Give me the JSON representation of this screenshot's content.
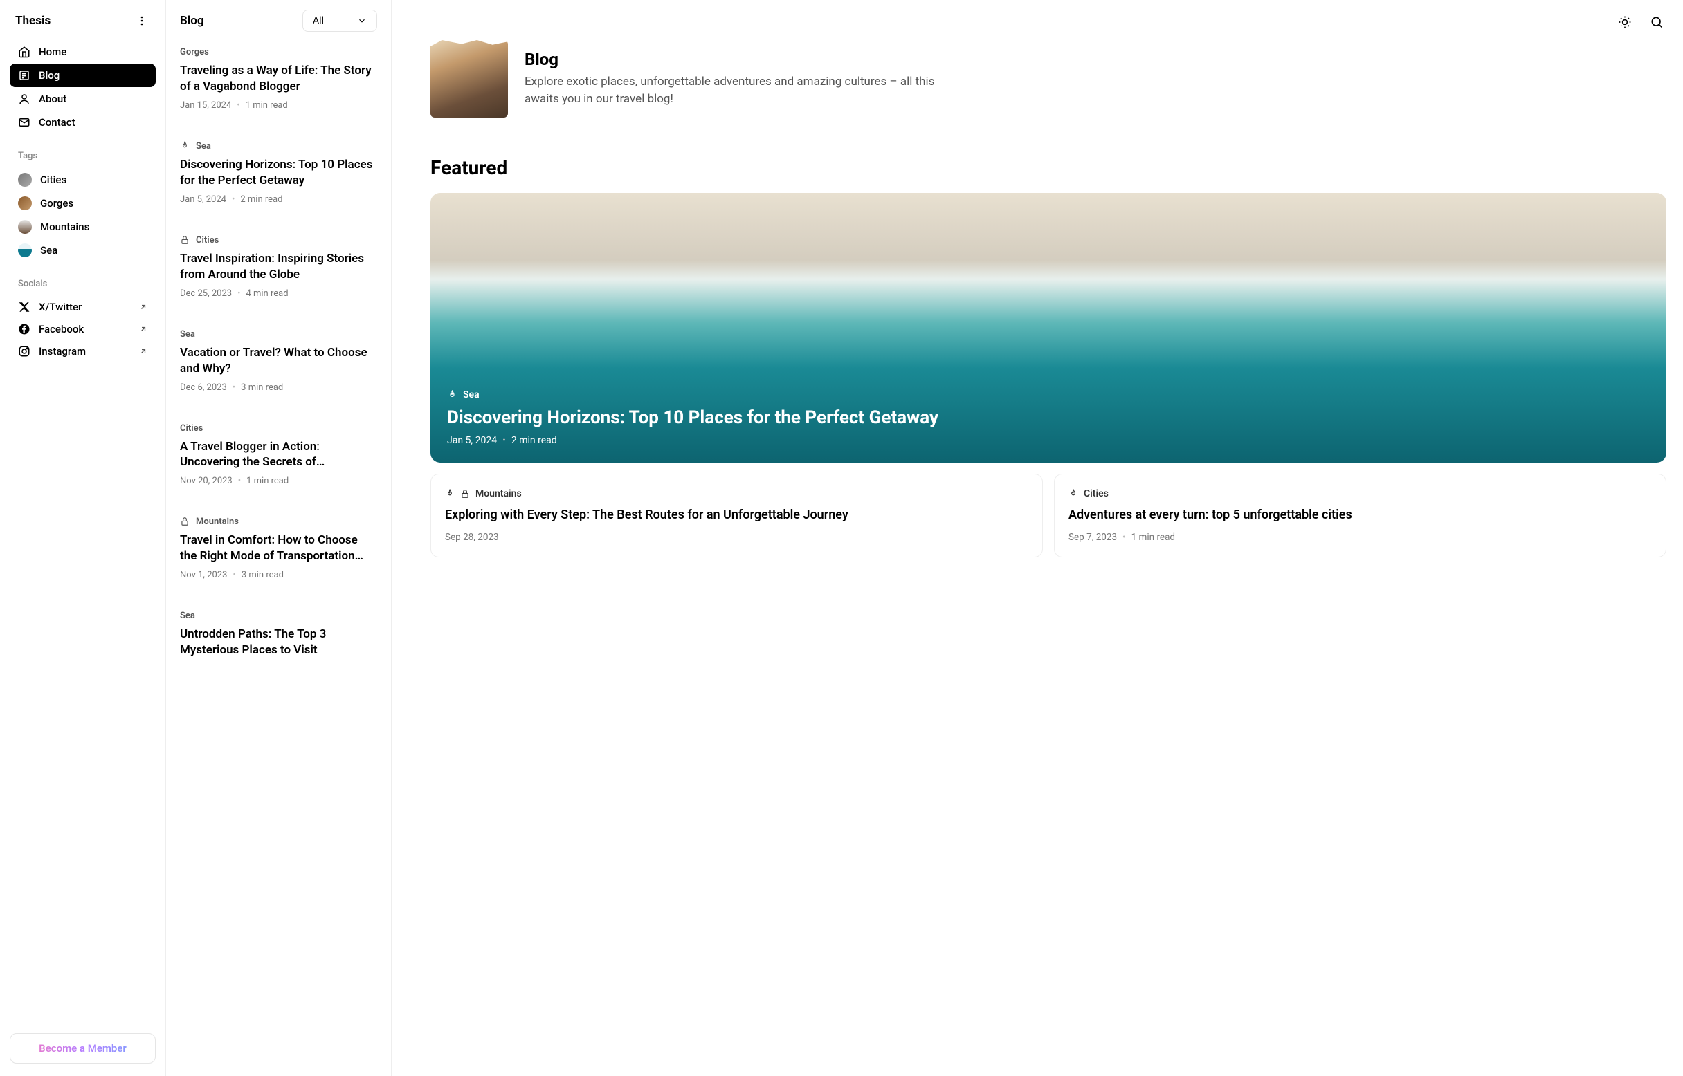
{
  "site": {
    "title": "Thesis",
    "member_cta": "Become a Member"
  },
  "nav": [
    {
      "label": "Home",
      "icon": "home-icon"
    },
    {
      "label": "Blog",
      "icon": "blog-icon",
      "active": true
    },
    {
      "label": "About",
      "icon": "about-icon"
    },
    {
      "label": "Contact",
      "icon": "contact-icon"
    }
  ],
  "tags_label": "Tags",
  "tags": [
    {
      "label": "Cities"
    },
    {
      "label": "Gorges"
    },
    {
      "label": "Mountains"
    },
    {
      "label": "Sea"
    }
  ],
  "socials_label": "Socials",
  "socials": [
    {
      "label": "X/Twitter"
    },
    {
      "label": "Facebook"
    },
    {
      "label": "Instagram"
    }
  ],
  "middle": {
    "title": "Blog",
    "filter": "All",
    "posts": [
      {
        "tag": "Gorges",
        "title": "Traveling as a Way of Life: The Story of a Vagabond Blogger",
        "date": "Jan 15, 2024",
        "read": "1 min read",
        "featured": false,
        "locked": false
      },
      {
        "tag": "Sea",
        "title": "Discovering Horizons: Top 10 Places for the Perfect Getaway",
        "date": "Jan 5, 2024",
        "read": "2 min read",
        "featured": true,
        "locked": false
      },
      {
        "tag": "Cities",
        "title": "Travel Inspiration: Inspiring Stories from Around the Globe",
        "date": "Dec 25, 2023",
        "read": "4 min read",
        "featured": false,
        "locked": true
      },
      {
        "tag": "Sea",
        "title": "Vacation or Travel? What to Choose and Why?",
        "date": "Dec 6, 2023",
        "read": "3 min read",
        "featured": false,
        "locked": false
      },
      {
        "tag": "Cities",
        "title": "A Travel Blogger in Action: Uncovering the Secrets of…",
        "date": "Nov 20, 2023",
        "read": "1 min read",
        "featured": false,
        "locked": false
      },
      {
        "tag": "Mountains",
        "title": "Travel in Comfort: How to Choose the Right Mode of Transportation…",
        "date": "Nov 1, 2023",
        "read": "3 min read",
        "featured": false,
        "locked": true
      },
      {
        "tag": "Sea",
        "title": "Untrodden Paths: The Top 3 Mysterious Places to Visit",
        "date": "",
        "read": "",
        "featured": false,
        "locked": false
      }
    ]
  },
  "main": {
    "blog_title": "Blog",
    "blog_desc": "Explore exotic places, unforgettable adventures and amazing cultures – all this awaits you in our travel blog!",
    "featured_heading": "Featured",
    "hero": {
      "tag": "Sea",
      "title": "Discovering Horizons: Top 10 Places for the Perfect Getaway",
      "date": "Jan 5, 2024",
      "read": "2 min read"
    },
    "cards": [
      {
        "tag": "Mountains",
        "title": "Exploring with Every Step: The Best Routes for an Unforgettable Journey",
        "date": "Sep 28, 2023",
        "read": "",
        "featured": true,
        "locked": true
      },
      {
        "tag": "Cities",
        "title": "Adventures at every turn: top 5 unforgettable cities",
        "date": "Sep 7, 2023",
        "read": "1 min read",
        "featured": true,
        "locked": false
      }
    ]
  }
}
